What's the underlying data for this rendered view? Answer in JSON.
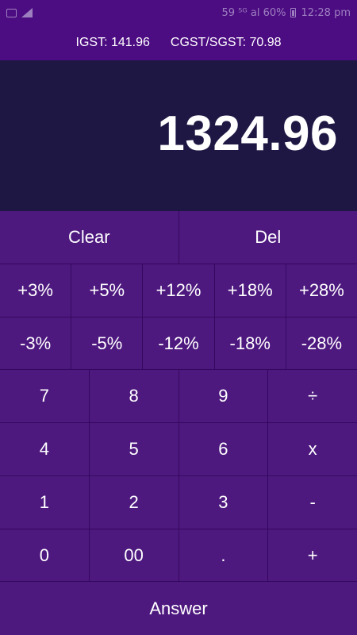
{
  "status_bar": {
    "left_icons": [
      "screen-icon",
      "signal-icon"
    ],
    "right_text": "59 ⁵ᴳ al 60%",
    "time": "12:28 pm"
  },
  "tax": {
    "igst": "IGST: 141.96",
    "cgst_sgst": "CGST/SGST: 70.98"
  },
  "display": {
    "value": "1324.96"
  },
  "keys": {
    "clear": "Clear",
    "del": "Del",
    "plus3": "+3%",
    "plus5": "+5%",
    "plus12": "+12%",
    "plus18": "+18%",
    "plus28": "+28%",
    "minus3": "-3%",
    "minus5": "-5%",
    "minus12": "-12%",
    "minus18": "-18%",
    "minus28": "-28%",
    "d7": "7",
    "d8": "8",
    "d9": "9",
    "divide": "÷",
    "d4": "4",
    "d5": "5",
    "d6": "6",
    "multiply": "x",
    "d1": "1",
    "d2": "2",
    "d3": "3",
    "minus": "-",
    "d0": "0",
    "d00": "00",
    "dot": ".",
    "plus": "+",
    "answer": "Answer"
  },
  "colors": {
    "header": "#4d0d82",
    "display_bg": "#1e1744",
    "key_bg": "#4e197f",
    "key_border": "#34085e"
  }
}
